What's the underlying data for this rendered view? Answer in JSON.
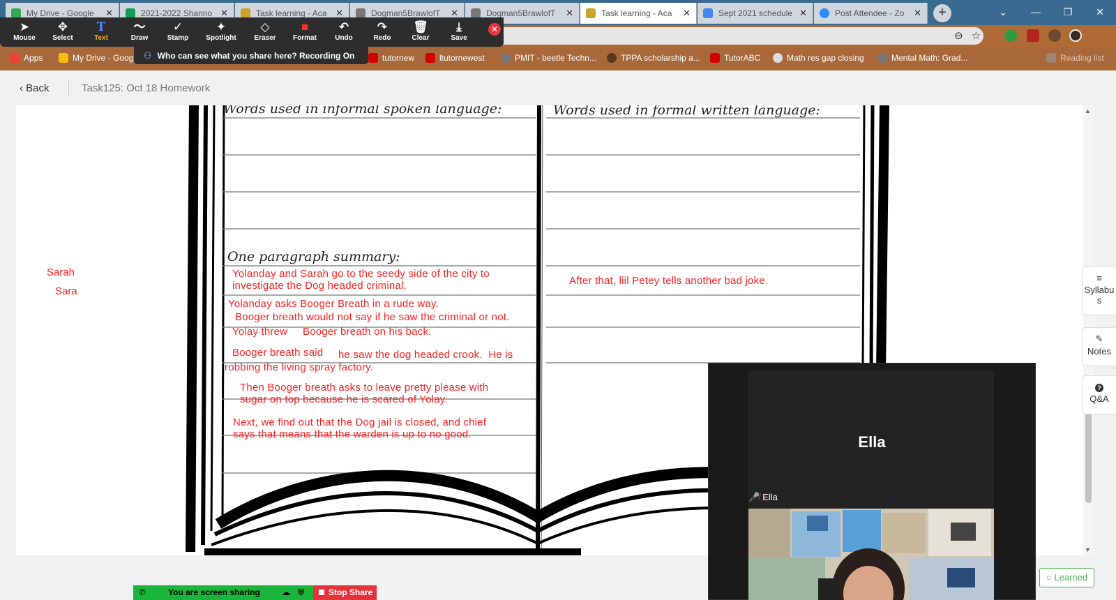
{
  "browser": {
    "tabs": [
      {
        "label": "My Drive - Google",
        "icon": "google-drive-icon",
        "color": "#34a853"
      },
      {
        "label": "2021-2022 Shanno",
        "icon": "sheets-icon",
        "color": "#0f9d58"
      },
      {
        "label": "Task learning - Aca",
        "icon": "site-icon",
        "color": "#c9a227"
      },
      {
        "label": "Dogman5BrawlofT",
        "icon": "globe-icon",
        "color": "#777777"
      },
      {
        "label": "Dogman5BrawlofT",
        "icon": "globe-icon",
        "color": "#777777"
      },
      {
        "label": "Task learning - Aca",
        "icon": "site-icon",
        "color": "#c9a227"
      },
      {
        "label": "Sept 2021 schedule",
        "icon": "docs-icon",
        "color": "#4285f4"
      },
      {
        "label": "Post Attendee - Zo",
        "icon": "zoom-icon",
        "color": "#2d8cff"
      }
    ],
    "tab_close": "✕",
    "new_tab": "+",
    "bookmarks": [
      {
        "label": "Apps",
        "icon": "apps-grid-icon",
        "color": "#ea4335"
      },
      {
        "label": "My Drive - Goog",
        "icon": "google-drive-icon",
        "color": "#fbbc05"
      },
      {
        "label": "tutornew",
        "icon": "info-icon",
        "color": "#d50000"
      },
      {
        "label": "ltutornewest",
        "icon": "info-icon",
        "color": "#d50000"
      },
      {
        "label": "PMIT - beetle Techn...",
        "icon": "globe-icon",
        "color": "#777777"
      },
      {
        "label": "TPPA scholarship a...",
        "icon": "seal-icon",
        "color": "#5a3a1a"
      },
      {
        "label": "TutorABC",
        "icon": "info-icon",
        "color": "#d50000"
      },
      {
        "label": "Math res gap closing",
        "icon": "globe-icon",
        "color": "#dddddd"
      },
      {
        "label": "Mental Math: Grad...",
        "icon": "globe-icon",
        "color": "#777777"
      },
      {
        "label": "Reading list",
        "icon": "reading-list-icon",
        "color": "#999999"
      }
    ]
  },
  "zoom_toolbar": {
    "tools": [
      {
        "label": "Mouse",
        "icon": "cursor-icon",
        "glyph": "➤"
      },
      {
        "label": "Select",
        "icon": "move-icon",
        "glyph": "✥"
      },
      {
        "label": "Text",
        "icon": "text-icon",
        "glyph": "T",
        "active": true
      },
      {
        "label": "Draw",
        "icon": "draw-icon",
        "glyph": "〜"
      },
      {
        "label": "Stamp",
        "icon": "stamp-icon",
        "glyph": "✓"
      },
      {
        "label": "Spotlight",
        "icon": "spotlight-icon",
        "glyph": "✦"
      },
      {
        "label": "Eraser",
        "icon": "eraser-icon",
        "glyph": "◇"
      },
      {
        "label": "Format",
        "icon": "format-icon",
        "glyph": "■"
      },
      {
        "label": "Undo",
        "icon": "undo-icon",
        "glyph": "↶"
      },
      {
        "label": "Redo",
        "icon": "redo-icon",
        "glyph": "↷"
      },
      {
        "label": "Clear",
        "icon": "trash-icon",
        "glyph": "🗑"
      },
      {
        "label": "Save",
        "icon": "save-icon",
        "glyph": "⤓"
      }
    ],
    "recording_banner": "Who can see what you share here? Recording On"
  },
  "page": {
    "back_label": "Back",
    "breadcrumb": "Task125:  Oct 18 Homework"
  },
  "worksheet": {
    "heading_left": "Words used in informal spoken language:",
    "heading_right": "Words used in formal written language:",
    "summary_heading": "One paragraph summary:",
    "names": [
      "Sarah",
      "Sara"
    ],
    "annotations": [
      "Yolanday and Sarah go to the seedy side of the city to\ninvestigate the Dog headed criminal.",
      "Yolanday asks Booger Breath in a rude way.",
      "Booger breath would not say if he saw the criminal or not.",
      "Yolay threw     Booger breath on his back.",
      "Booger breath said",
      "he saw the dog headed crook.  He is",
      "robbing the living spray factory.",
      "Then Booger breath asks to leave pretty please with\nsugar on top because he is scared of Yolay.",
      "Next, we find out that the Dog jail is closed, and chief\nsays that means that the warden is up to no good.",
      "After that, liil Petey tells another bad joke."
    ]
  },
  "side_panel": [
    {
      "label": "Syllabus",
      "icon": "menu-icon",
      "glyph": "≡"
    },
    {
      "label": "Notes",
      "icon": "pencil-icon",
      "glyph": "✎"
    },
    {
      "label": "Q&A",
      "icon": "help-icon",
      "glyph": "?"
    }
  ],
  "learned_label": "Learned",
  "screen_share": {
    "status": "You are screen sharing",
    "stop_label": "Stop Share"
  },
  "video": {
    "participant_name": "Ella",
    "participant_label": "Ella"
  },
  "colors": {
    "annotation": "#ff1f1f",
    "share_green": "#1cb53b",
    "stop_red": "#e5333b"
  }
}
